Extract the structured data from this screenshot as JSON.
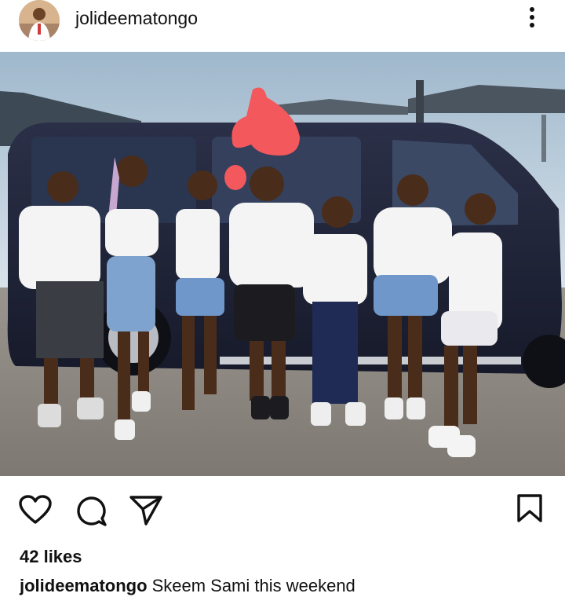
{
  "post": {
    "username": "jolideematongo",
    "likes_text": "42 likes",
    "caption_user": "jolideematongo",
    "caption_text": "Skeem Sami this weekend"
  },
  "icons": {
    "more": "more-vertical-icon",
    "like": "heart-icon",
    "comment": "comment-bubble-icon",
    "share": "send-icon",
    "save": "bookmark-icon"
  },
  "colors": {
    "text": "#111111",
    "background": "#ffffff",
    "doodle": "#f2585c"
  }
}
